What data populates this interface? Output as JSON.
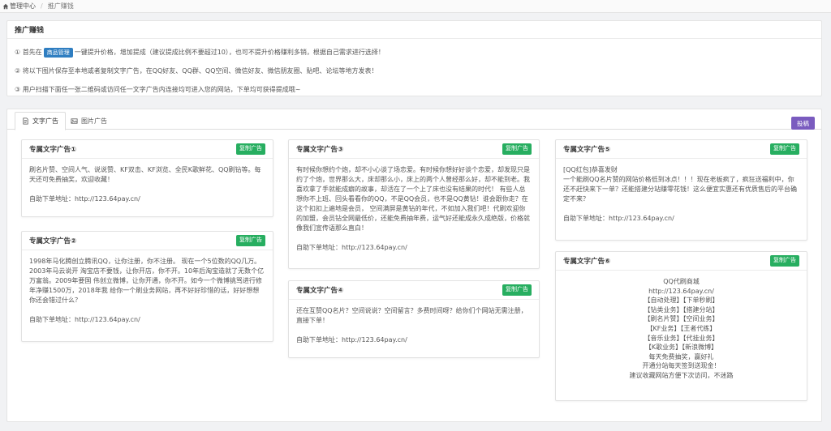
{
  "breadcrumb": {
    "home": "管理中心",
    "current": "推广赚钱"
  },
  "intro": {
    "title": "推广赚钱",
    "step1_prefix": "① 首先在",
    "step1_badge": "商品管理",
    "step1_suffix": "一键提升价格，增加提成（建议提成比例不要超过10），也可不提升价格赚利多销，根据自己需求进行选择！",
    "step2": "② 将以下图片保存至本地或者复制文字广告，在QQ好友、QQ群、QQ空间、微信好友、微信朋友圈、贴吧、论坛等地方发表！",
    "step3": "③ 用户扫描下面任一张二维码或访问任一文字广告内连接均可进入您的网站，下单均可获得提成哦~"
  },
  "tabs": [
    {
      "label": "文字广告",
      "active": true
    },
    {
      "label": "图片广告",
      "active": false
    }
  ],
  "report_button": "投稿",
  "copy_label": "复制广告",
  "order_label": "自助下单地址：http://123.64pay.cn/",
  "cards": [
    {
      "title": "专属文字广告①",
      "text": "刷名片赞、空间人气、说说赞、KF双击、KF浏览、全民K歌鲜花、QQ刷钻等。每天还可免费抽奖，欢迎收藏！"
    },
    {
      "title": "专属文字广告②",
      "text": "1998年马化腾创立腾讯QQ，让你注册，你不注册。 现在一个5位数的QQ几万。2003年马云说开 淘宝店不要钱，让你开店，你不开。10年后淘宝造就了无数个亿万富翁。2009年要国 伟创立微博，让你开通，你不开。如今一个微博挑骂进行修年净赚1500万，2018年我 给你一个刷业务网站，再不好好珍惜的话，好好想想你还会错过什么？"
    },
    {
      "title": "专属文字广告③",
      "text": "有时候你想约个炮，却不小心谈了场恋爱。有时候你想好好谈个恋爱，却发现只是约了个炮，世界那么大，床却那么小，床上的两个人曾经那么好，却不能到老。我喜欢拿了手就能成癖的故事，却活在了一个上了床也没有结果的时代！ 有些人总想你不上班、回头看看你的QQ，不是QQ会员，也不是QQ黄钻！谁会跟你走？在这个扣扣上遍地是会员， 空间满屏是黄钻的年代，不如加入我们吧！代刷欢迎你的加盟，会员钻全网最低价，还能免费抽年费，运气好还能成永久成绝版，价格就像我们宣传语那么直白！"
    },
    {
      "title": "专属文字广告④",
      "text": "还在互赞QQ名片？空间说说？空间留言？多费时间呀？给你们个网站无需注册，直接下单！"
    },
    {
      "title": "专属文字广告⑤",
      "text": "[QQ红包]恭喜发财\n一个能刷QQ名片赞的网站价格低到冰点！！！现在老板疯了，疯狂送福利中，你还不赶快来下一单？还能搭建分站赚零花钱！这么便宜实惠还有优质售后的平台确定不来？"
    },
    {
      "title": "专属文字广告⑥",
      "lines": [
        "QQ代刷商城",
        "http://123.64pay.cn/",
        "【自动处理】【下单秒刷】",
        "【钻类业务】【搭建分站】",
        "【刷名片赞】【空间业务】",
        "【KF业务】【王者代练】",
        "【音乐业务】【代挂业务】",
        "【K歌业务】【新浪微博】",
        "每天免费抽奖，赢好礼",
        "开通分站每天签到送现金！",
        "建议收藏网站方便下次访问，不迷路"
      ]
    }
  ]
}
